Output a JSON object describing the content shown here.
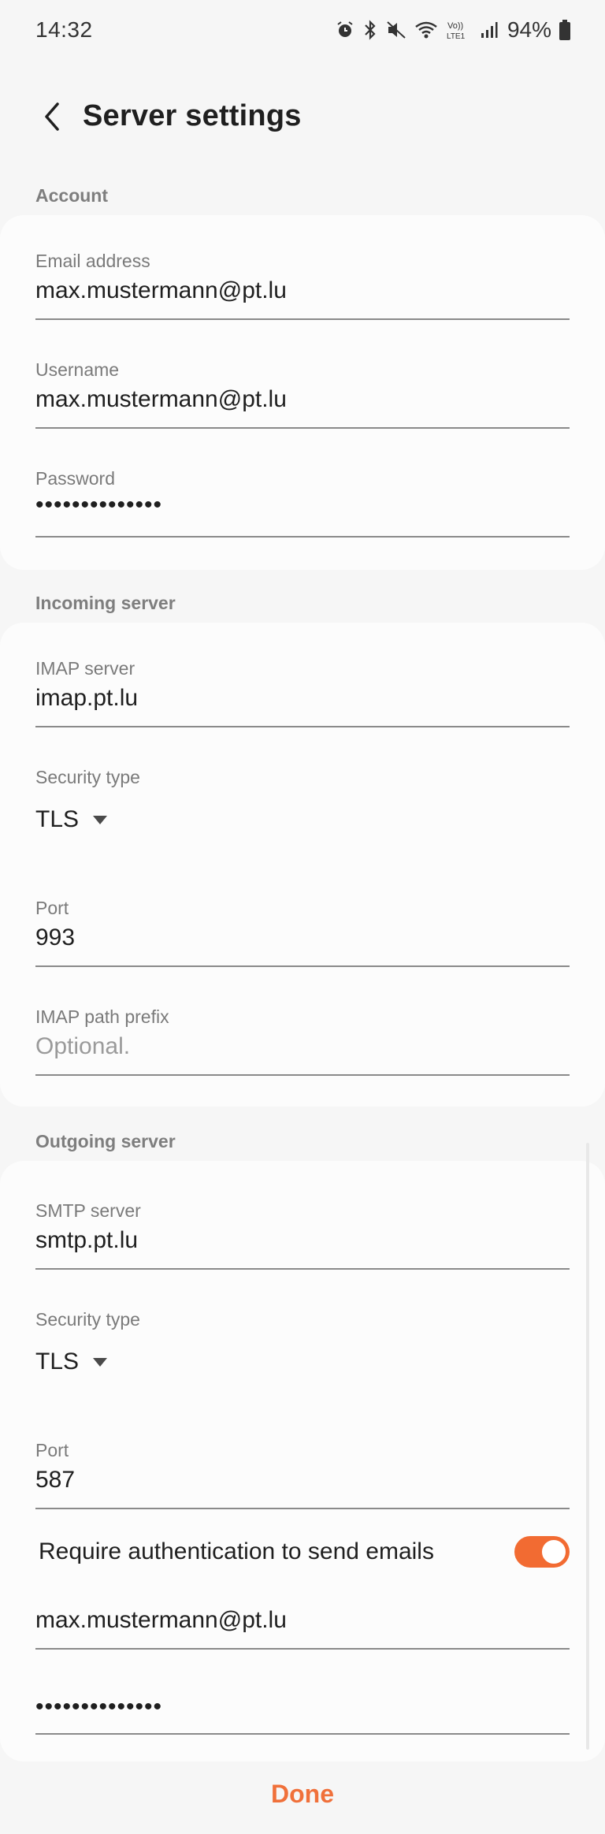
{
  "status_bar": {
    "time": "14:32",
    "battery": "94%",
    "icons": [
      "alarm-icon",
      "bluetooth-icon",
      "mute-icon",
      "wifi-icon",
      "volte-icon",
      "signal-icon",
      "battery-icon"
    ]
  },
  "header": {
    "title": "Server settings",
    "back_icon": "chevron-left-icon"
  },
  "account": {
    "section_label": "Account",
    "email_label": "Email address",
    "email_value": "max.mustermann@pt.lu",
    "username_label": "Username",
    "username_value": "max.mustermann@pt.lu",
    "password_label": "Password",
    "password_value": "••••••••••••••"
  },
  "incoming": {
    "section_label": "Incoming server",
    "server_label": "IMAP server",
    "server_value": "imap.pt.lu",
    "security_label": "Security type",
    "security_value": "TLS",
    "port_label": "Port",
    "port_value": "993",
    "prefix_label": "IMAP path prefix",
    "prefix_placeholder": "Optional."
  },
  "outgoing": {
    "section_label": "Outgoing server",
    "server_label": "SMTP server",
    "server_value": "smtp.pt.lu",
    "security_label": "Security type",
    "security_value": "TLS",
    "port_label": "Port",
    "port_value": "587",
    "auth_label": "Require authentication to send emails",
    "auth_enabled": true,
    "auth_username": "max.mustermann@pt.lu",
    "auth_password": "••••••••••••••"
  },
  "footer": {
    "done_label": "Done"
  },
  "colors": {
    "accent": "#f26b32",
    "done": "#f0703a",
    "background": "#f6f6f6",
    "card": "#fcfcfc"
  }
}
